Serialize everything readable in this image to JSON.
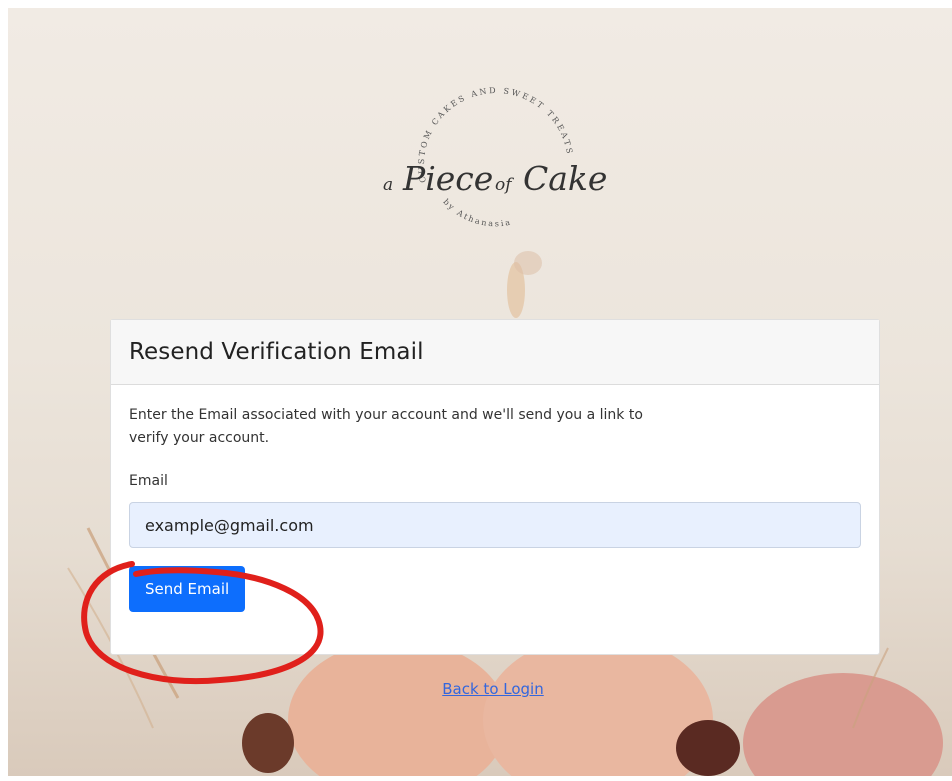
{
  "logo": {
    "ring_text": "CUSTOM CAKES AND SWEET TREATS",
    "brand_a": "a",
    "brand_piece": "Piece",
    "brand_of": "of",
    "brand_cake": "Cake",
    "by_line": "by Athanasia"
  },
  "card": {
    "title": "Resend Verification Email",
    "description": "Enter the Email associated with your account and we'll send you a link to verify your account.",
    "email_label": "Email",
    "email_value": "example@gmail.com",
    "send_label": "Send Email"
  },
  "footer": {
    "back_link": "Back to Login"
  },
  "colors": {
    "primary": "#0d6efd",
    "annotation": "#e0201b",
    "input_bg": "#e8f0fe"
  }
}
